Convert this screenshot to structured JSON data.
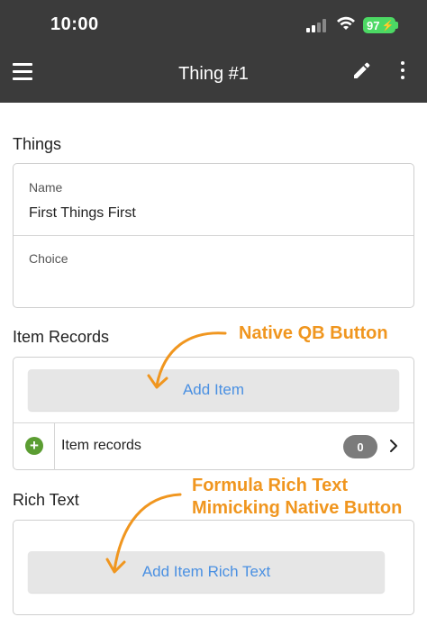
{
  "status_bar": {
    "time": "10:00",
    "battery": "97"
  },
  "header": {
    "title": "Thing #1"
  },
  "things_section": {
    "label": "Things",
    "name_label": "Name",
    "name_value": "First Things First",
    "choice_label": "Choice",
    "choice_value": ""
  },
  "item_records_section": {
    "label": "Item Records",
    "add_button_label": "Add  Item",
    "records_row_label": "Item records",
    "records_count": "0"
  },
  "rich_text_section": {
    "label": "Rich Text",
    "button_label": "Add Item Rich Text"
  },
  "annotations": {
    "native_button": "Native QB Button",
    "rich_text_line1": "Formula Rich Text",
    "rich_text_line2": "Mimicking Native Button",
    "color": "#f0961f"
  },
  "colors": {
    "header_bg": "#3b3b3b",
    "link_blue": "#4a90e2",
    "plus_green": "#5b9d32",
    "battery_green": "#4cd964"
  },
  "icons": [
    "menu-icon",
    "pencil-icon",
    "kebab-icon",
    "plus-circle-icon",
    "chevron-right-icon",
    "signal-icon",
    "wifi-icon",
    "battery-icon"
  ]
}
